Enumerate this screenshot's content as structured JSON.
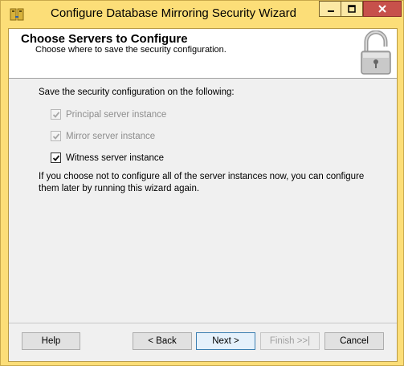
{
  "window": {
    "title": "Configure Database Mirroring Security Wizard",
    "accent_color": "#fcde78",
    "close_color": "#c7514b"
  },
  "header": {
    "title": "Choose Servers to Configure",
    "subtitle": "Choose where to save the security configuration."
  },
  "content": {
    "prompt": "Save the security configuration on the following:",
    "options": [
      {
        "label": "Principal server instance",
        "checked": true,
        "enabled": false
      },
      {
        "label": "Mirror server instance",
        "checked": true,
        "enabled": false
      },
      {
        "label": "Witness server instance",
        "checked": true,
        "enabled": true
      }
    ],
    "note": "If you choose not to configure all of the server instances now, you can configure them later by running this wizard again."
  },
  "buttons": {
    "help": "Help",
    "back": "< Back",
    "next": "Next >",
    "finish": "Finish >>|",
    "cancel": "Cancel"
  },
  "icons": {
    "app": "database-icon",
    "lock": "padlock-icon",
    "minimize": "minimize-icon",
    "maximize": "maximize-icon",
    "close": "close-icon"
  }
}
